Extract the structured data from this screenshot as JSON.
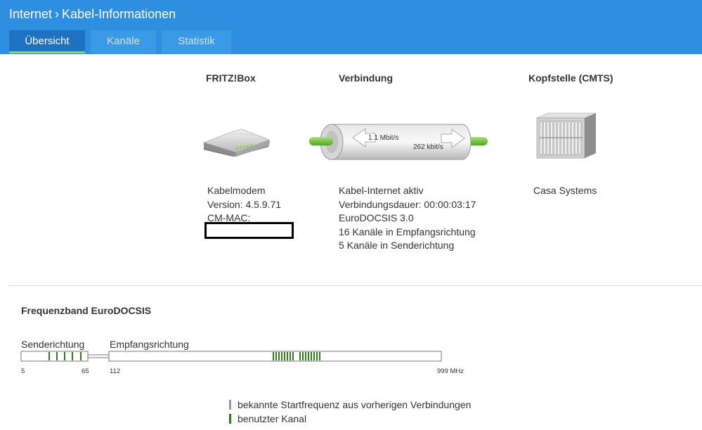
{
  "header": {
    "breadcrumb_root": "Internet",
    "breadcrumb_page": "Kabel-Informationen",
    "tabs": [
      {
        "label": "Übersicht",
        "active": true
      },
      {
        "label": "Kanäle",
        "active": false
      },
      {
        "label": "Statistik",
        "active": false
      }
    ]
  },
  "fritzbox": {
    "title": "FRITZ!Box",
    "icon": "router-icon",
    "lines": [
      "Kabelmodem",
      "Version: 4.5.9.71",
      "CM-MAC:"
    ]
  },
  "connection": {
    "title": "Verbindung",
    "icon": "connection-tube-icon",
    "downstream_rate": "1.1 Mbit/s",
    "upstream_rate": "262 kbit/s",
    "lines": [
      "Kabel-Internet aktiv",
      "Verbindungsdauer: 00:00:03:17",
      "EuroDOCSIS 3.0",
      "16 Kanäle in Empfangsrichtung",
      "5 Kanäle in Senderichtung"
    ]
  },
  "cmts": {
    "title": "Kopfstelle (CMTS)",
    "icon": "server-rack-icon",
    "lines": [
      "Casa Systems"
    ]
  },
  "frequency": {
    "title": "Frequenzband EuroDOCSIS",
    "upstream_label": "Senderichtung",
    "downstream_label": "Empfangsrichtung",
    "tick_5": "5",
    "tick_65": "65",
    "tick_112": "112",
    "tick_999": "999 MHz",
    "upstream_channels_count": 5,
    "downstream_channels_count": 16,
    "used_color": "#2e7d1a"
  },
  "legend": {
    "known_label": "bekannte Startfrequenz aus vorherigen Verbindungen",
    "used_label": "benutzter Kanal",
    "known_color": "#999999",
    "used_color": "#2e7d1a"
  }
}
